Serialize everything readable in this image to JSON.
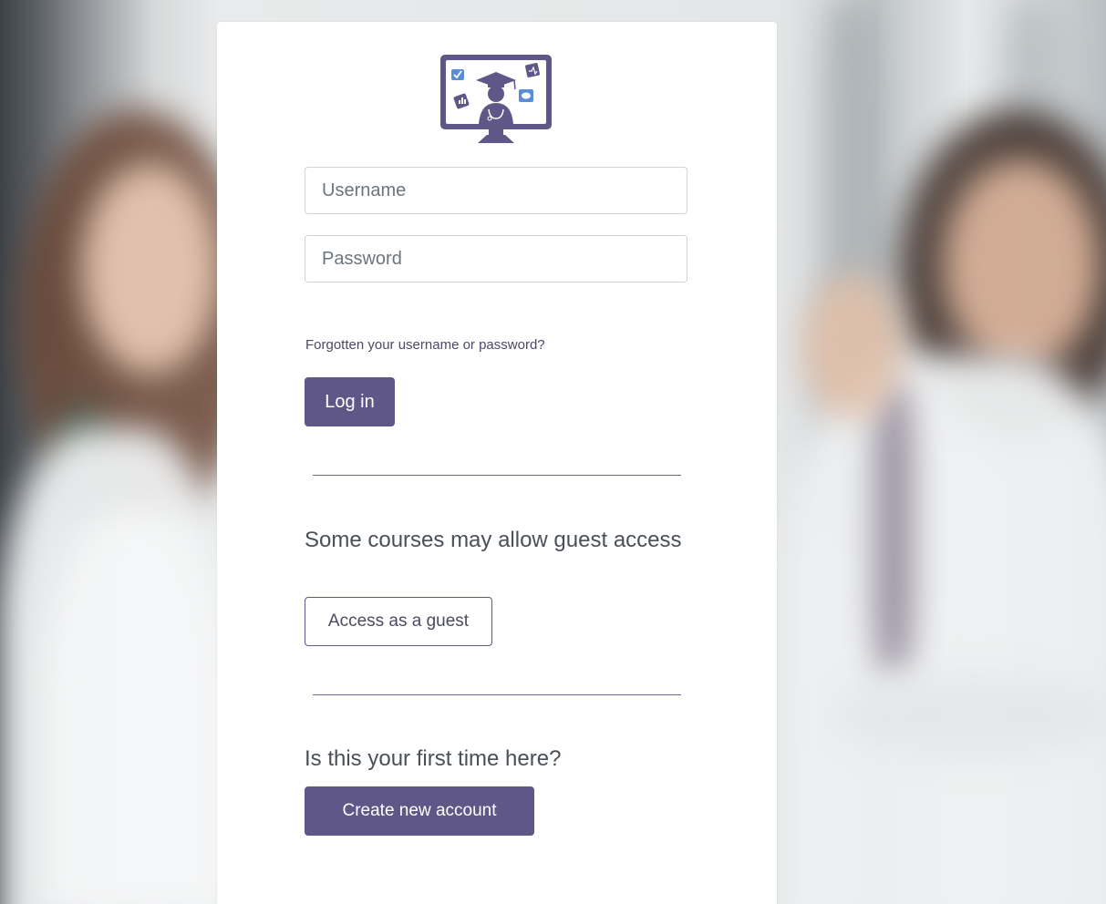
{
  "login": {
    "username_placeholder": "Username",
    "password_placeholder": "Password",
    "forgot_link": "Forgotten your username or password?",
    "login_button": "Log in"
  },
  "guest": {
    "heading": "Some courses may allow guest access",
    "button": "Access as a guest"
  },
  "signup": {
    "heading": "Is this your first time here?",
    "button": "Create new account"
  },
  "icons": {
    "logo": "graduate-monitor-logo-icon"
  },
  "colors": {
    "brand": "#5e5787",
    "card_background": "#ffffff",
    "divider": "#6c6a8e",
    "text": "#495057"
  }
}
